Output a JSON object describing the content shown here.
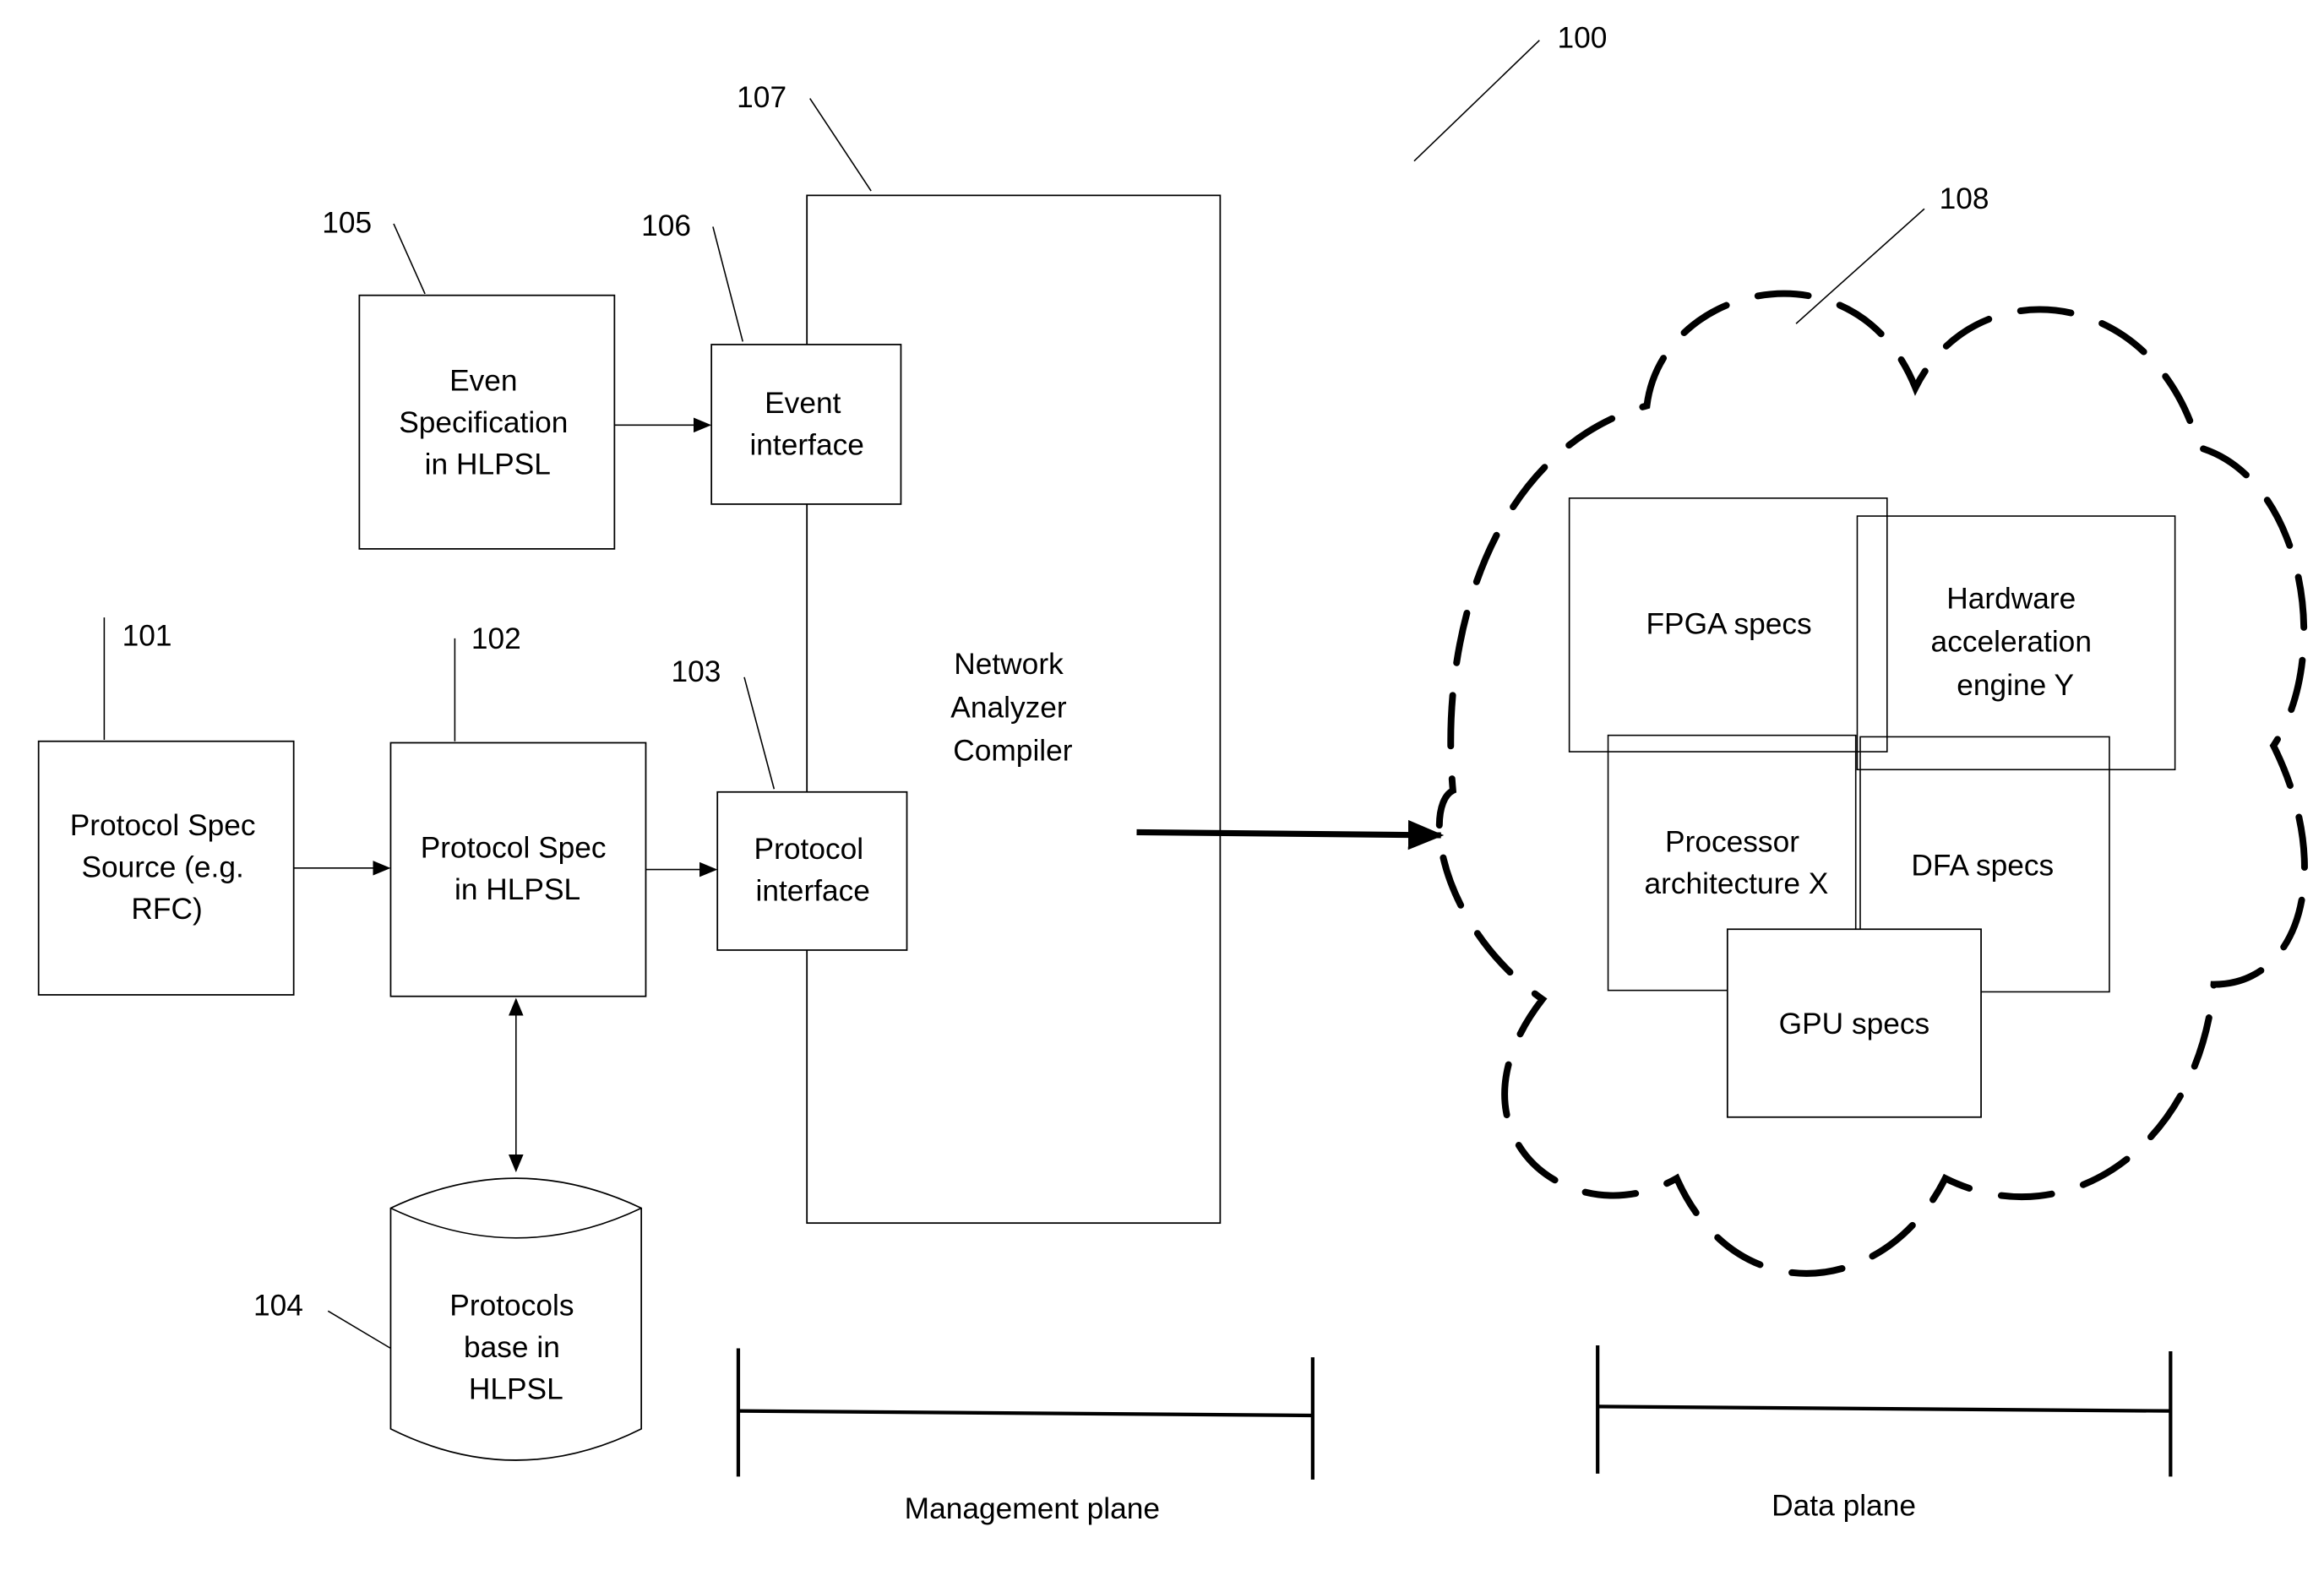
{
  "figure_ref": "100",
  "blocks": {
    "protocol_spec_source": {
      "ref": "101",
      "lines": [
        "Protocol Spec",
        "Source (e.g.",
        "RFC)"
      ]
    },
    "protocol_spec_hlpsl": {
      "ref": "102",
      "lines": [
        "Protocol Spec",
        "in HLPSL"
      ]
    },
    "protocol_interface": {
      "ref": "103",
      "lines": [
        "Protocol",
        "interface"
      ]
    },
    "protocols_base": {
      "ref": "104",
      "lines": [
        "Protocols",
        "base in",
        "HLPSL"
      ]
    },
    "event_spec": {
      "ref": "105",
      "lines": [
        "Even",
        "Specification",
        "in HLPSL"
      ]
    },
    "event_interface": {
      "ref": "106",
      "lines": [
        "Event",
        "interface"
      ]
    },
    "compiler": {
      "ref": "107",
      "lines": [
        "Network",
        "Analyzer",
        "Compiler"
      ]
    },
    "hardware_cloud": {
      "ref": "108"
    }
  },
  "cloud_items": {
    "fpga": {
      "lines": [
        "FPGA specs"
      ]
    },
    "hw_accel": {
      "lines": [
        "Hardware",
        "acceleration",
        "engine Y"
      ]
    },
    "processor": {
      "lines": [
        "Processor",
        "architecture X"
      ]
    },
    "dfa": {
      "lines": [
        "DFA specs"
      ]
    },
    "gpu": {
      "lines": [
        "GPU specs"
      ]
    }
  },
  "planes": {
    "management": "Management plane",
    "data": "Data plane"
  }
}
